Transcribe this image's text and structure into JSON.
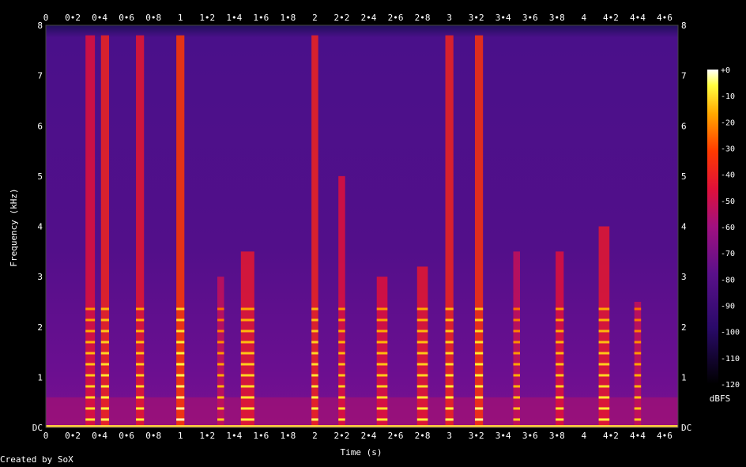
{
  "chart_data": {
    "type": "heatmap",
    "xlabel": "Time (s)",
    "ylabel": "Frequency (kHz)",
    "xlim": [
      0,
      4.7
    ],
    "ylim": [
      0,
      8
    ],
    "x_ticks": [
      "0",
      "0•2",
      "0•4",
      "0•6",
      "0•8",
      "1",
      "1•2",
      "1•4",
      "1•6",
      "1•8",
      "2",
      "2•2",
      "2•4",
      "2•6",
      "2•8",
      "3",
      "3•2",
      "3•4",
      "3•6",
      "3•8",
      "4",
      "4•2",
      "4•4",
      "4•6"
    ],
    "x_tick_values": [
      0,
      0.2,
      0.4,
      0.6,
      0.8,
      1.0,
      1.2,
      1.4,
      1.6,
      1.8,
      2.0,
      2.2,
      2.4,
      2.6,
      2.8,
      3.0,
      3.2,
      3.4,
      3.6,
      3.8,
      4.0,
      4.2,
      4.4,
      4.6
    ],
    "y_ticks": [
      "DC",
      "1",
      "2",
      "3",
      "4",
      "5",
      "6",
      "7",
      "8"
    ],
    "y_tick_values": [
      0,
      1,
      2,
      3,
      4,
      5,
      6,
      7,
      8
    ],
    "colorbar": {
      "label": "dBFS",
      "ticks": [
        "+0",
        "-10",
        "-20",
        "-30",
        "-40",
        "-50",
        "-60",
        "-70",
        "-80",
        "-90",
        "-100",
        "-110",
        "-120"
      ],
      "tick_values": [
        0,
        -10,
        -20,
        -30,
        -40,
        -50,
        -60,
        -70,
        -80,
        -90,
        -100,
        -110,
        -120
      ],
      "range": [
        -120,
        0
      ]
    },
    "bursts": [
      {
        "t": 0.33,
        "w": 0.07,
        "fmax": 7.8,
        "level": -40
      },
      {
        "t": 0.44,
        "w": 0.06,
        "fmax": 7.8,
        "level": -35
      },
      {
        "t": 0.7,
        "w": 0.06,
        "fmax": 7.8,
        "level": -38
      },
      {
        "t": 1.0,
        "w": 0.06,
        "fmax": 7.8,
        "level": -30
      },
      {
        "t": 1.3,
        "w": 0.05,
        "fmax": 3.0,
        "level": -45
      },
      {
        "t": 1.5,
        "w": 0.1,
        "fmax": 3.5,
        "level": -38
      },
      {
        "t": 2.0,
        "w": 0.05,
        "fmax": 7.8,
        "level": -35
      },
      {
        "t": 2.2,
        "w": 0.05,
        "fmax": 5.0,
        "level": -40
      },
      {
        "t": 2.5,
        "w": 0.08,
        "fmax": 3.0,
        "level": -40
      },
      {
        "t": 2.8,
        "w": 0.08,
        "fmax": 3.2,
        "level": -38
      },
      {
        "t": 3.0,
        "w": 0.06,
        "fmax": 7.8,
        "level": -35
      },
      {
        "t": 3.22,
        "w": 0.06,
        "fmax": 7.8,
        "level": -32
      },
      {
        "t": 3.5,
        "w": 0.05,
        "fmax": 3.5,
        "level": -45
      },
      {
        "t": 3.82,
        "w": 0.06,
        "fmax": 3.5,
        "level": -40
      },
      {
        "t": 4.15,
        "w": 0.08,
        "fmax": 4.0,
        "level": -38
      },
      {
        "t": 4.4,
        "w": 0.05,
        "fmax": 2.5,
        "level": -45
      }
    ]
  },
  "footer": {
    "credit": "Created by SoX"
  }
}
